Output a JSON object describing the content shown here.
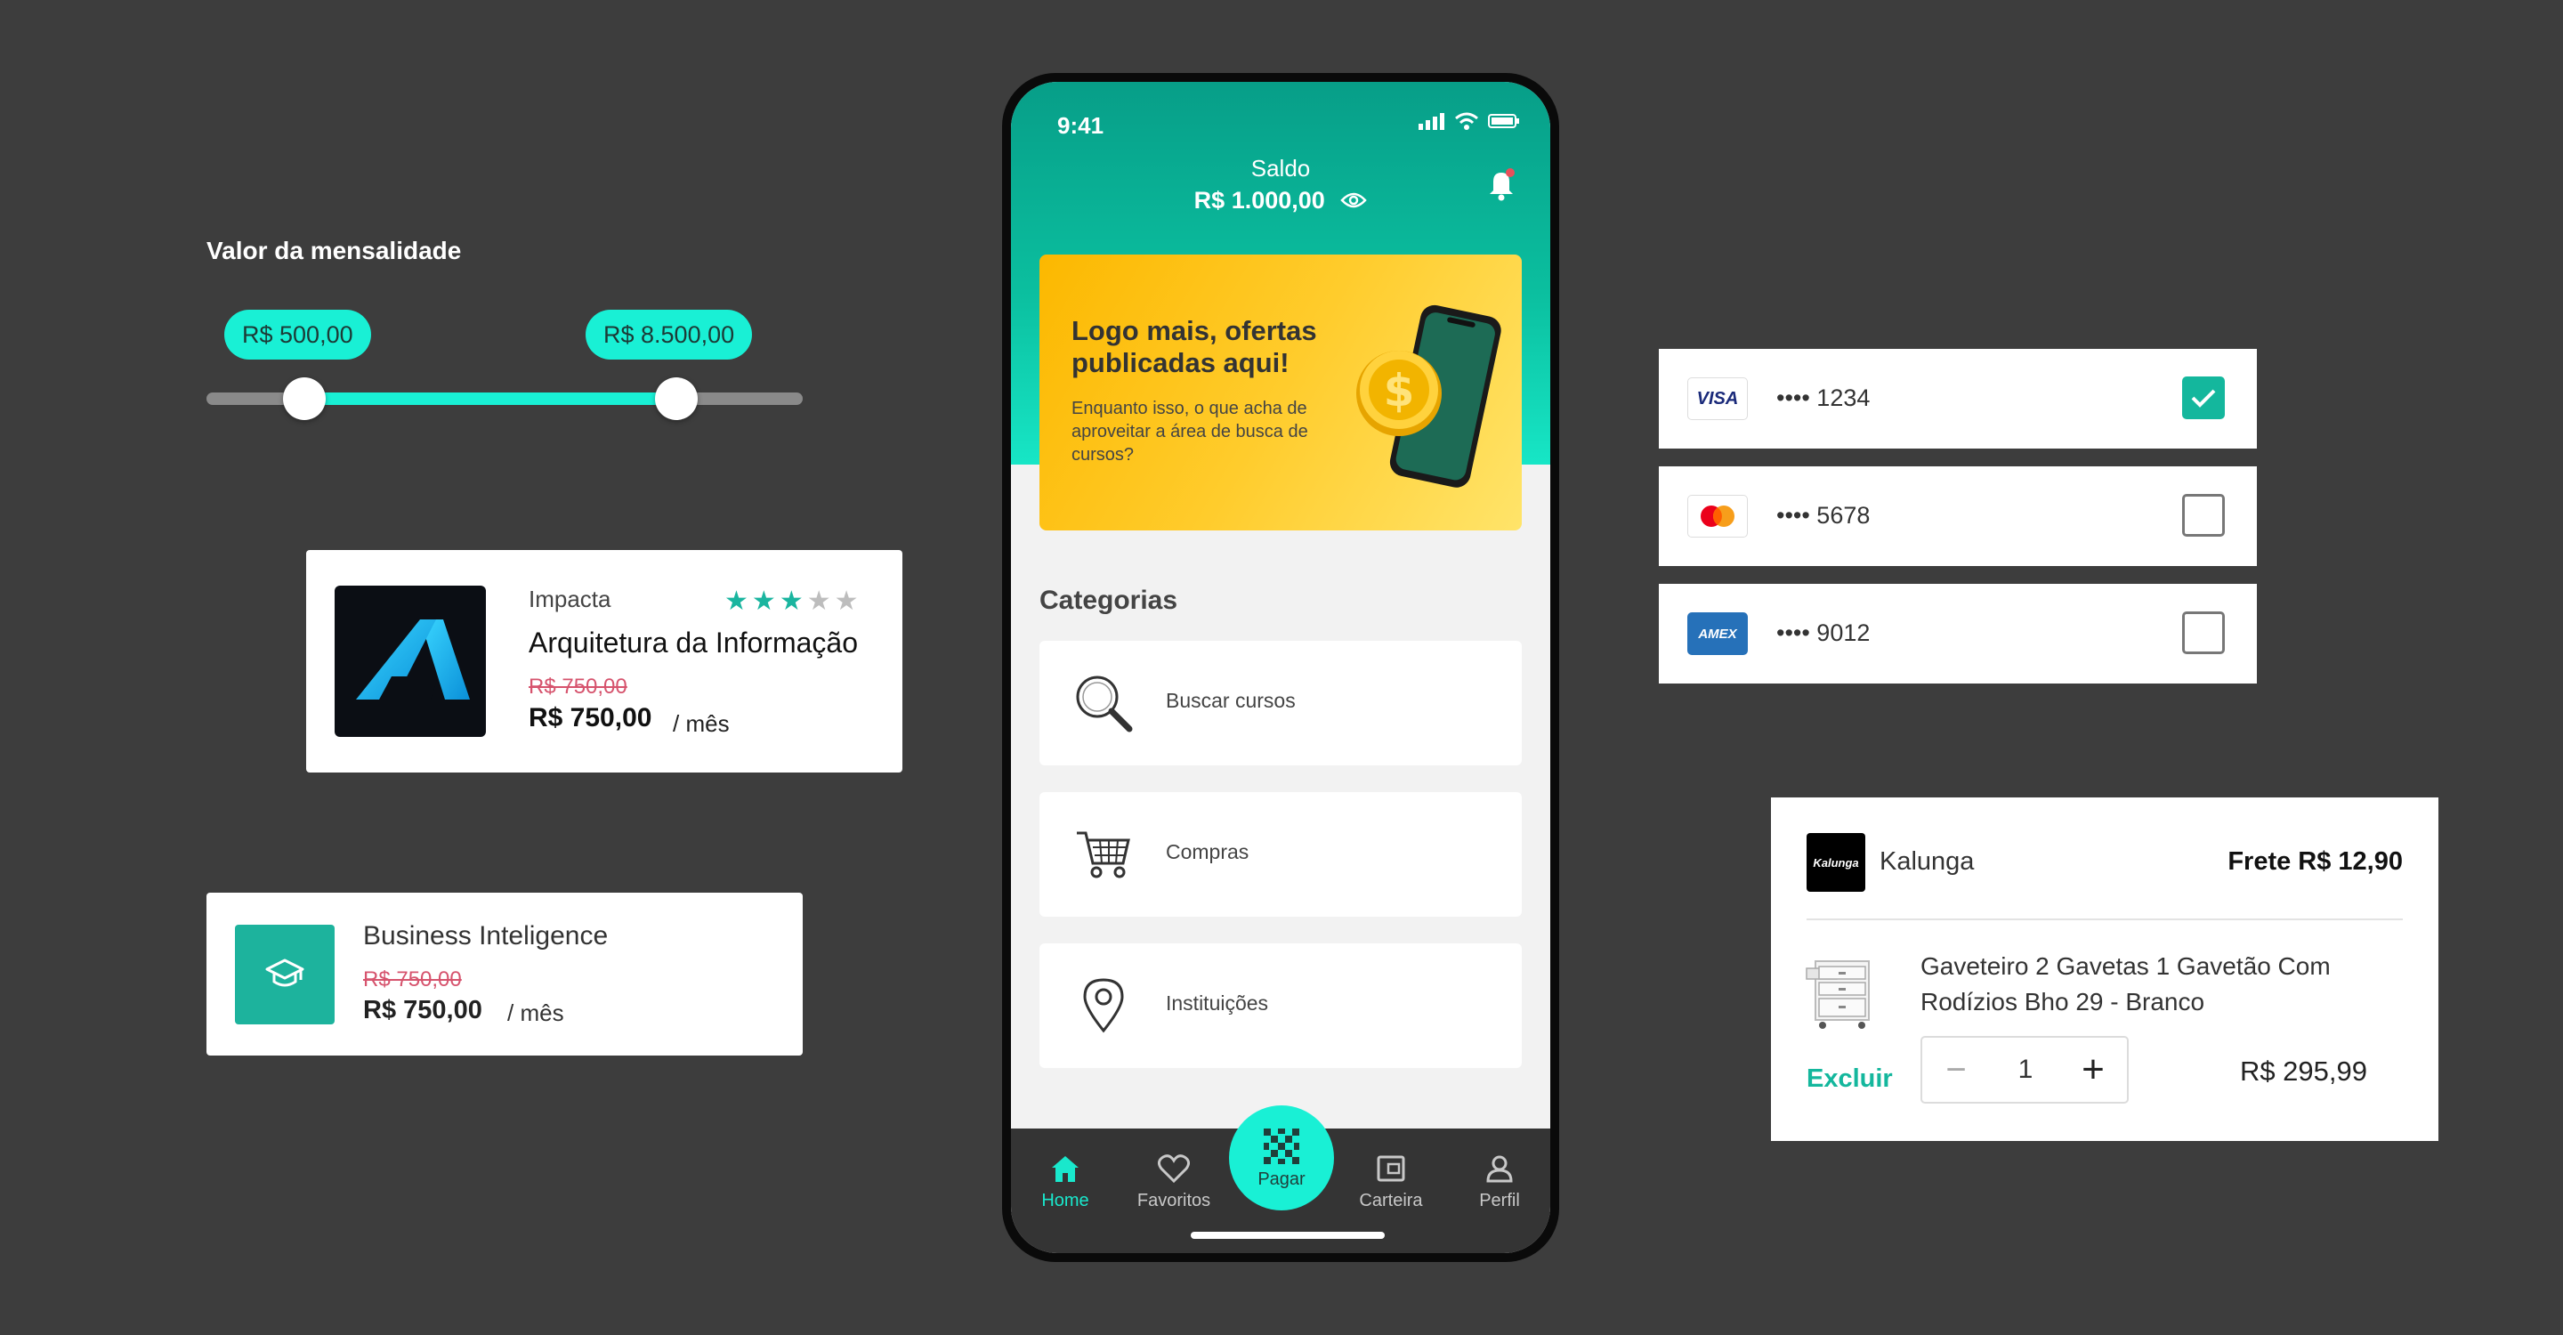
{
  "slider": {
    "title": "Valor da mensalidade",
    "min_label": "R$ 500,00",
    "max_label": "R$ 8.500,00",
    "accent": "#19f0d5"
  },
  "course1": {
    "brand": "Impacta",
    "rating": 3,
    "rating_max": 5,
    "title": "Arquitetura da Informação",
    "old_price": "R$ 750,00",
    "price": "R$ 750,00",
    "per": "/ mês"
  },
  "course2": {
    "title": "Business Inteligence",
    "old_price": "R$ 750,00",
    "price": "R$ 750,00",
    "per": "/ mês",
    "icon": "graduation-cap-icon"
  },
  "phone": {
    "time": "9:41",
    "saldo_label": "Saldo",
    "saldo_value": "R$ 1.000,00",
    "promo_title": "Logo mais, ofertas publicadas aqui!",
    "promo_sub": "Enquanto isso, o que acha de aproveitar a área de busca de cursos?",
    "categorias_title": "Categorias",
    "categories": [
      {
        "label": "Buscar cursos",
        "icon": "search-icon"
      },
      {
        "label": "Compras",
        "icon": "cart-icon"
      },
      {
        "label": "Instituições",
        "icon": "location-pin-icon"
      }
    ],
    "tabs": [
      {
        "label": "Home",
        "icon": "home-icon",
        "active": true
      },
      {
        "label": "Favoritos",
        "icon": "heart-icon"
      },
      {
        "label": "Carteira",
        "icon": "wallet-icon"
      },
      {
        "label": "Perfil",
        "icon": "user-icon"
      }
    ],
    "pay_label": "Pagar",
    "brand_color": "#0bbf9f"
  },
  "cards": [
    {
      "brand": "VISA",
      "number": "•••• 1234",
      "checked": true
    },
    {
      "brand": "Mastercard",
      "number": "•••• 5678",
      "checked": false
    },
    {
      "brand": "AMEX",
      "number": "•••• 9012",
      "checked": false
    }
  ],
  "cart": {
    "store_logo_text": "Kalunga",
    "store": "Kalunga",
    "frete": "Frete R$ 12,90",
    "product": "Gaveteiro 2 Gavetas 1 Gavetão Com Rodízios Bho 29 - Branco",
    "remove": "Excluir",
    "quantity": "1",
    "minus": "−",
    "plus": "+",
    "price": "R$ 295,99"
  }
}
